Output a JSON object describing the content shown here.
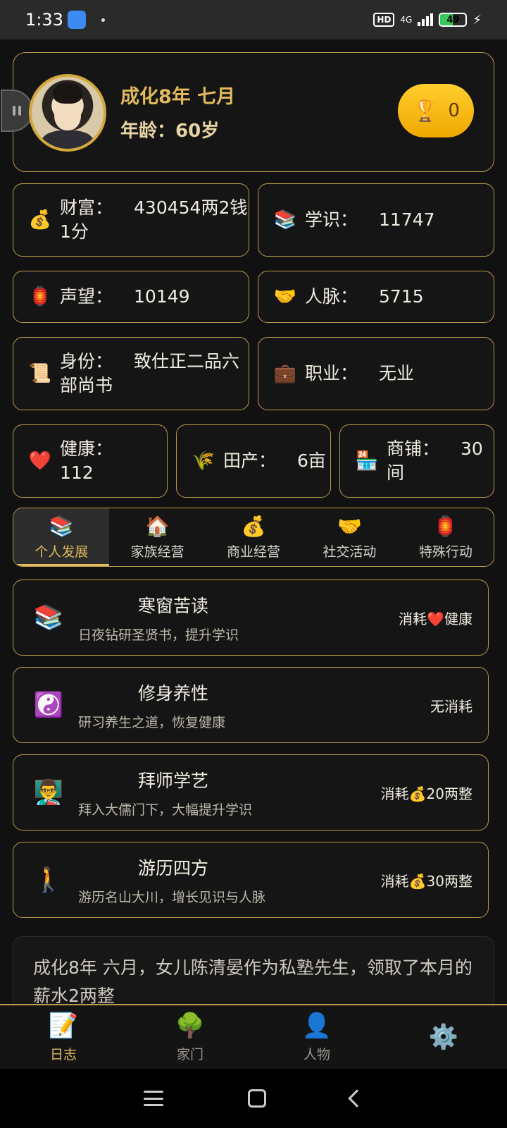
{
  "status_bar": {
    "time": "1:33",
    "hd": "HD",
    "network": "4G",
    "battery_percent": "49",
    "battery_level": 0.49
  },
  "profile": {
    "date": "成化8年 七月",
    "age_label": "年龄：",
    "age_value": "60岁",
    "trophy_count": "0",
    "trophy_icon": "trophy-icon"
  },
  "stats": {
    "wealth": {
      "icon": "💰",
      "label": "财富：",
      "value": "430454两2钱1分"
    },
    "knowledge": {
      "icon": "📚",
      "label": "学识：",
      "value": "11747"
    },
    "reputation": {
      "icon": "🏮",
      "label": "声望：",
      "value": "10149"
    },
    "connections": {
      "icon": "🤝",
      "label": "人脉：",
      "value": "5715"
    },
    "identity": {
      "icon": "📜",
      "label": "身份：",
      "value": "致仕正二品六部尚书"
    },
    "occupation": {
      "icon": "💼",
      "label": "职业：",
      "value": "无业"
    },
    "health": {
      "icon": "❤️",
      "label": "健康：",
      "value": "112"
    },
    "farmland": {
      "icon": "🌾",
      "label": "田产：",
      "value": "6亩"
    },
    "shops": {
      "icon": "🏪",
      "label": "商铺：",
      "value": "30间"
    }
  },
  "tabs": [
    {
      "icon": "📚",
      "label": "个人发展"
    },
    {
      "icon": "🏠",
      "label": "家族经营"
    },
    {
      "icon": "💰",
      "label": "商业经营"
    },
    {
      "icon": "🤝",
      "label": "社交活动"
    },
    {
      "icon": "🏮",
      "label": "特殊行动"
    }
  ],
  "actions": [
    {
      "icon": "📚",
      "title": "寒窗苦读",
      "desc": "日夜钻研圣贤书，提升学识",
      "cost": "消耗❤️健康"
    },
    {
      "icon": "☯️",
      "title": "修身养性",
      "desc": "研习养生之道，恢复健康",
      "cost": "无消耗"
    },
    {
      "icon": "👨‍🏫",
      "title": "拜师学艺",
      "desc": "拜入大儒门下，大幅提升学识",
      "cost": "消耗💰20两整"
    },
    {
      "icon": "🚶",
      "title": "游历四方",
      "desc": "游历名山大川，增长见识与人脉",
      "cost": "消耗💰30两整"
    }
  ],
  "log": {
    "text": "成化8年 六月，女儿陈清晏作为私塾先生，领取了本月的薪水2两整"
  },
  "bottom_nav": [
    {
      "icon": "📝",
      "label": "日志"
    },
    {
      "icon": "🌳",
      "label": "家门"
    },
    {
      "icon": "👤",
      "label": "人物"
    },
    {
      "icon": "⚙️",
      "label": ""
    }
  ]
}
